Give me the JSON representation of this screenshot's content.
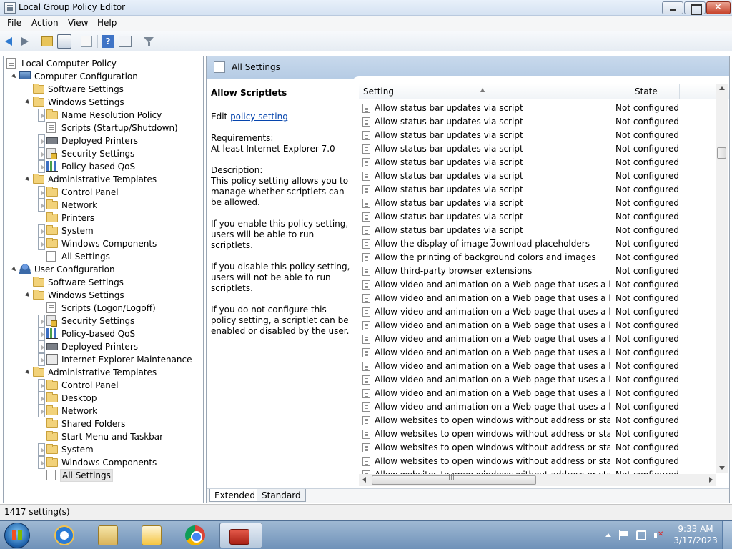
{
  "window": {
    "title": "Local Group Policy Editor"
  },
  "menu": [
    "File",
    "Action",
    "View",
    "Help"
  ],
  "toolbar_icons": [
    "back-icon",
    "forward-icon",
    "up-folder-icon",
    "show-hide-tree-icon",
    "export-list-icon",
    "help-icon",
    "properties-icon",
    "filter-icon"
  ],
  "tree": [
    {
      "label": "Local Computer Policy",
      "level": 0,
      "icon": "policy-doc-icon",
      "expander": "none"
    },
    {
      "label": "Computer Configuration",
      "level": 1,
      "icon": "computer-icon",
      "expander": "down"
    },
    {
      "label": "Software Settings",
      "level": 2,
      "icon": "folder-icon",
      "expander": "none"
    },
    {
      "label": "Windows Settings",
      "level": 2,
      "icon": "folder-icon",
      "expander": "down"
    },
    {
      "label": "Name Resolution Policy",
      "level": 3,
      "icon": "folder-icon",
      "expander": "right"
    },
    {
      "label": "Scripts (Startup/Shutdown)",
      "level": 3,
      "icon": "script-icon",
      "expander": "none"
    },
    {
      "label": "Deployed Printers",
      "level": 3,
      "icon": "printer-icon",
      "expander": "right"
    },
    {
      "label": "Security Settings",
      "level": 3,
      "icon": "security-icon",
      "expander": "right"
    },
    {
      "label": "Policy-based QoS",
      "level": 3,
      "icon": "qos-chart-icon",
      "expander": "right"
    },
    {
      "label": "Administrative Templates",
      "level": 2,
      "icon": "folder-icon",
      "expander": "down"
    },
    {
      "label": "Control Panel",
      "level": 3,
      "icon": "folder-icon",
      "expander": "right"
    },
    {
      "label": "Network",
      "level": 3,
      "icon": "folder-icon",
      "expander": "right"
    },
    {
      "label": "Printers",
      "level": 3,
      "icon": "folder-icon",
      "expander": "none"
    },
    {
      "label": "System",
      "level": 3,
      "icon": "folder-icon",
      "expander": "right"
    },
    {
      "label": "Windows Components",
      "level": 3,
      "icon": "folder-icon",
      "expander": "right"
    },
    {
      "label": "All Settings",
      "level": 3,
      "icon": "all-settings-icon",
      "expander": "none"
    },
    {
      "label": "User Configuration",
      "level": 1,
      "icon": "user-icon",
      "expander": "down"
    },
    {
      "label": "Software Settings",
      "level": 2,
      "icon": "folder-icon",
      "expander": "none"
    },
    {
      "label": "Windows Settings",
      "level": 2,
      "icon": "folder-icon",
      "expander": "down"
    },
    {
      "label": "Scripts (Logon/Logoff)",
      "level": 3,
      "icon": "script-icon",
      "expander": "none"
    },
    {
      "label": "Security Settings",
      "level": 3,
      "icon": "security-icon",
      "expander": "right"
    },
    {
      "label": "Policy-based QoS",
      "level": 3,
      "icon": "qos-chart-icon",
      "expander": "right"
    },
    {
      "label": "Deployed Printers",
      "level": 3,
      "icon": "printer-icon",
      "expander": "right"
    },
    {
      "label": "Internet Explorer Maintenance",
      "level": 3,
      "icon": "ie-maintenance-icon",
      "expander": "right"
    },
    {
      "label": "Administrative Templates",
      "level": 2,
      "icon": "folder-icon",
      "expander": "down"
    },
    {
      "label": "Control Panel",
      "level": 3,
      "icon": "folder-icon",
      "expander": "right"
    },
    {
      "label": "Desktop",
      "level": 3,
      "icon": "folder-icon",
      "expander": "right"
    },
    {
      "label": "Network",
      "level": 3,
      "icon": "folder-icon",
      "expander": "right"
    },
    {
      "label": "Shared Folders",
      "level": 3,
      "icon": "folder-icon",
      "expander": "none"
    },
    {
      "label": "Start Menu and Taskbar",
      "level": 3,
      "icon": "folder-icon",
      "expander": "none"
    },
    {
      "label": "System",
      "level": 3,
      "icon": "folder-icon",
      "expander": "right"
    },
    {
      "label": "Windows Components",
      "level": 3,
      "icon": "folder-icon",
      "expander": "right"
    },
    {
      "label": "All Settings",
      "level": 3,
      "icon": "all-settings-icon",
      "expander": "none",
      "selected": true
    }
  ],
  "right_pane": {
    "header_title": "All Settings",
    "description": {
      "title": "Allow Scriptlets",
      "edit_prefix": "Edit ",
      "edit_link": "policy setting ",
      "requirements_label": "Requirements:",
      "requirements_value": "At least Internet Explorer 7.0",
      "description_label": "Description:",
      "description_text": "This policy setting allows you to manage whether scriptlets can be allowed.",
      "enable_text": "If you enable this policy setting, users will be able to run scriptlets.",
      "disable_text": "If you disable this policy setting, users will not be able to run scriptlets.",
      "notconfig_text": "If you do not configure this policy setting, a scriptlet can be enabled or disabled by the user."
    },
    "columns": {
      "setting": "Setting",
      "state": "State"
    },
    "rows": [
      {
        "name": "Allow status bar updates via script",
        "state": "Not configured"
      },
      {
        "name": "Allow status bar updates via script",
        "state": "Not configured"
      },
      {
        "name": "Allow status bar updates via script",
        "state": "Not configured"
      },
      {
        "name": "Allow status bar updates via script",
        "state": "Not configured"
      },
      {
        "name": "Allow status bar updates via script",
        "state": "Not configured"
      },
      {
        "name": "Allow status bar updates via script",
        "state": "Not configured"
      },
      {
        "name": "Allow status bar updates via script",
        "state": "Not configured"
      },
      {
        "name": "Allow status bar updates via script",
        "state": "Not configured"
      },
      {
        "name": "Allow status bar updates via script",
        "state": "Not configured"
      },
      {
        "name": "Allow status bar updates via script",
        "state": "Not configured"
      },
      {
        "name": "Allow the display of image download placeholders",
        "state": "Not configured"
      },
      {
        "name": "Allow the printing of background colors and images",
        "state": "Not configured"
      },
      {
        "name": "Allow third-party browser extensions",
        "state": "Not configured"
      },
      {
        "name": "Allow video and animation on a Web page that uses a legac...",
        "state": "Not configured"
      },
      {
        "name": "Allow video and animation on a Web page that uses a legac...",
        "state": "Not configured"
      },
      {
        "name": "Allow video and animation on a Web page that uses a legac...",
        "state": "Not configured"
      },
      {
        "name": "Allow video and animation on a Web page that uses a legac...",
        "state": "Not configured"
      },
      {
        "name": "Allow video and animation on a Web page that uses a legac...",
        "state": "Not configured"
      },
      {
        "name": "Allow video and animation on a Web page that uses a legac...",
        "state": "Not configured"
      },
      {
        "name": "Allow video and animation on a Web page that uses a legac...",
        "state": "Not configured"
      },
      {
        "name": "Allow video and animation on a Web page that uses a legac...",
        "state": "Not configured"
      },
      {
        "name": "Allow video and animation on a Web page that uses a legac...",
        "state": "Not configured"
      },
      {
        "name": "Allow video and animation on a Web page that uses a legac...",
        "state": "Not configured"
      },
      {
        "name": "Allow websites to open windows without address or status b...",
        "state": "Not configured"
      },
      {
        "name": "Allow websites to open windows without address or status b...",
        "state": "Not configured"
      },
      {
        "name": "Allow websites to open windows without address or status b...",
        "state": "Not configured"
      },
      {
        "name": "Allow websites to open windows without address or status b...",
        "state": "Not configured"
      },
      {
        "name": "Allow websites to open windows without address or status b...",
        "state": "Not configured"
      }
    ],
    "tabs": [
      "Extended",
      "Standard"
    ]
  },
  "status_bar": {
    "text": "1417 setting(s)"
  },
  "taskbar": {
    "apps": [
      "internet-explorer-icon",
      "windows-explorer-icon",
      "media-player-icon",
      "chrome-icon",
      "group-policy-toolbox-icon"
    ],
    "clock_time": "9:33 AM",
    "clock_date": "3/17/2023"
  }
}
